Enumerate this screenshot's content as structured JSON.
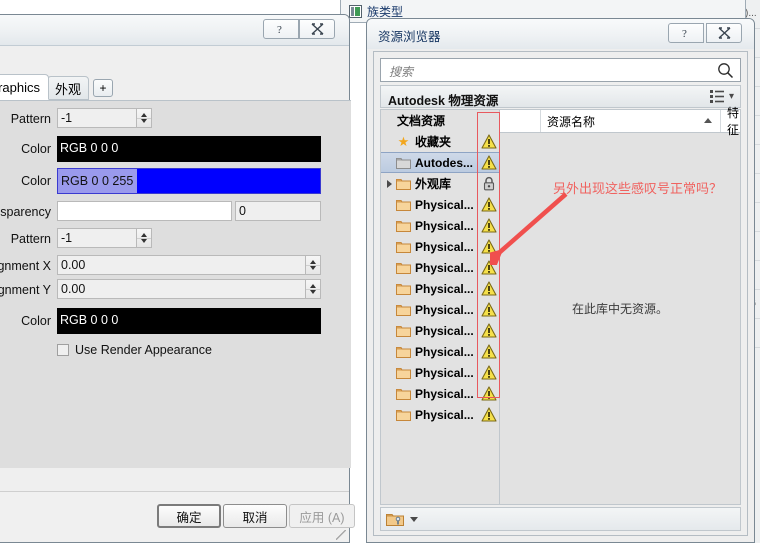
{
  "background_window": {
    "title": "族类型",
    "icon": "family-type-icon"
  },
  "left_dialog": {
    "help_glyph": "?",
    "close_glyph": "✕",
    "tabs": [
      {
        "label": "Graphics",
        "active": true
      },
      {
        "label": "外观",
        "active": false
      },
      {
        "label": "+",
        "active": false
      }
    ],
    "rows": [
      {
        "label": "Pattern",
        "type": "spin",
        "value": "-1"
      },
      {
        "label": "Color",
        "type": "swatch",
        "value": "RGB 0 0 0",
        "color": "#000000",
        "selected": false
      },
      {
        "label": "Color",
        "type": "swatch",
        "value": "RGB 0 0 255",
        "color": "#0000ff",
        "selected": true
      },
      {
        "label": "Transparency",
        "type": "dual",
        "value": "",
        "value2": "0"
      },
      {
        "label": "Pattern",
        "type": "spin",
        "value": "-1"
      },
      {
        "label": "Alignment X",
        "type": "wide-spin",
        "value": "0.00"
      },
      {
        "label": "Alignment Y",
        "type": "wide-spin",
        "value": "0.00"
      },
      {
        "label": "Color",
        "type": "swatch",
        "value": "RGB 0 0 0",
        "color": "#000000",
        "selected": false
      }
    ],
    "checkbox": {
      "label": "Use Render Appearance",
      "checked": false
    },
    "buttons": {
      "ok": "确定",
      "cancel": "取消",
      "apply": "应用 (A)"
    }
  },
  "resource_browser": {
    "title": "资源浏览器",
    "help_glyph": "?",
    "close_glyph": "✕",
    "search": {
      "placeholder": "搜索",
      "value": "",
      "icon": "search-icon"
    },
    "library_bar": {
      "title": "Autodesk 物理资源",
      "view_icon": "list-view-icon",
      "caret": "▾"
    },
    "tree": [
      {
        "label": "文档资源",
        "icon": "none",
        "status": "none",
        "header": true,
        "selected": false,
        "expander": false
      },
      {
        "label": "收藏夹",
        "icon": "star",
        "status": "warning",
        "header": false,
        "selected": false,
        "expander": false
      },
      {
        "label": "Autodes...",
        "icon": "folder-gray",
        "status": "warning",
        "header": false,
        "selected": true,
        "expander": false
      },
      {
        "label": "外观库",
        "icon": "folder-orange",
        "status": "lock",
        "header": false,
        "selected": false,
        "expander": true
      },
      {
        "label": "Physical...",
        "icon": "folder-orange",
        "status": "warning",
        "header": false,
        "selected": false,
        "expander": false
      },
      {
        "label": "Physical...",
        "icon": "folder-orange",
        "status": "warning",
        "header": false,
        "selected": false,
        "expander": false
      },
      {
        "label": "Physical...",
        "icon": "folder-orange",
        "status": "warning",
        "header": false,
        "selected": false,
        "expander": false
      },
      {
        "label": "Physical...",
        "icon": "folder-orange",
        "status": "warning",
        "header": false,
        "selected": false,
        "expander": false
      },
      {
        "label": "Physical...",
        "icon": "folder-orange",
        "status": "warning",
        "header": false,
        "selected": false,
        "expander": false
      },
      {
        "label": "Physical...",
        "icon": "folder-orange",
        "status": "warning",
        "header": false,
        "selected": false,
        "expander": false
      },
      {
        "label": "Physical...",
        "icon": "folder-orange",
        "status": "warning",
        "header": false,
        "selected": false,
        "expander": false
      },
      {
        "label": "Physical...",
        "icon": "folder-orange",
        "status": "warning",
        "header": false,
        "selected": false,
        "expander": false
      },
      {
        "label": "Physical...",
        "icon": "folder-orange",
        "status": "warning",
        "header": false,
        "selected": false,
        "expander": false
      },
      {
        "label": "Physical...",
        "icon": "folder-orange",
        "status": "warning",
        "header": false,
        "selected": false,
        "expander": false
      },
      {
        "label": "Physical...",
        "icon": "folder-orange",
        "status": "warning",
        "header": false,
        "selected": false,
        "expander": false
      }
    ],
    "columns": [
      {
        "label": "资源名称",
        "sorted": "asc"
      },
      {
        "label": "特征",
        "sorted": "none"
      }
    ],
    "empty_message": "在此库中无资源。",
    "bottom_bar": {
      "icon": "folder-tools-icon",
      "caret": "▾"
    }
  },
  "annotation": {
    "text": "另外出现这些感叹号正常吗？",
    "color": "#f0625f",
    "arrow": "red-arrow"
  },
  "background_right_rows": [
    ")...",
    ").",
    "t)",
    ")..",
    "..",
    "(')",
    ")",
    ")",
    ")",
    ")",
    "(G",
    "0-"
  ]
}
